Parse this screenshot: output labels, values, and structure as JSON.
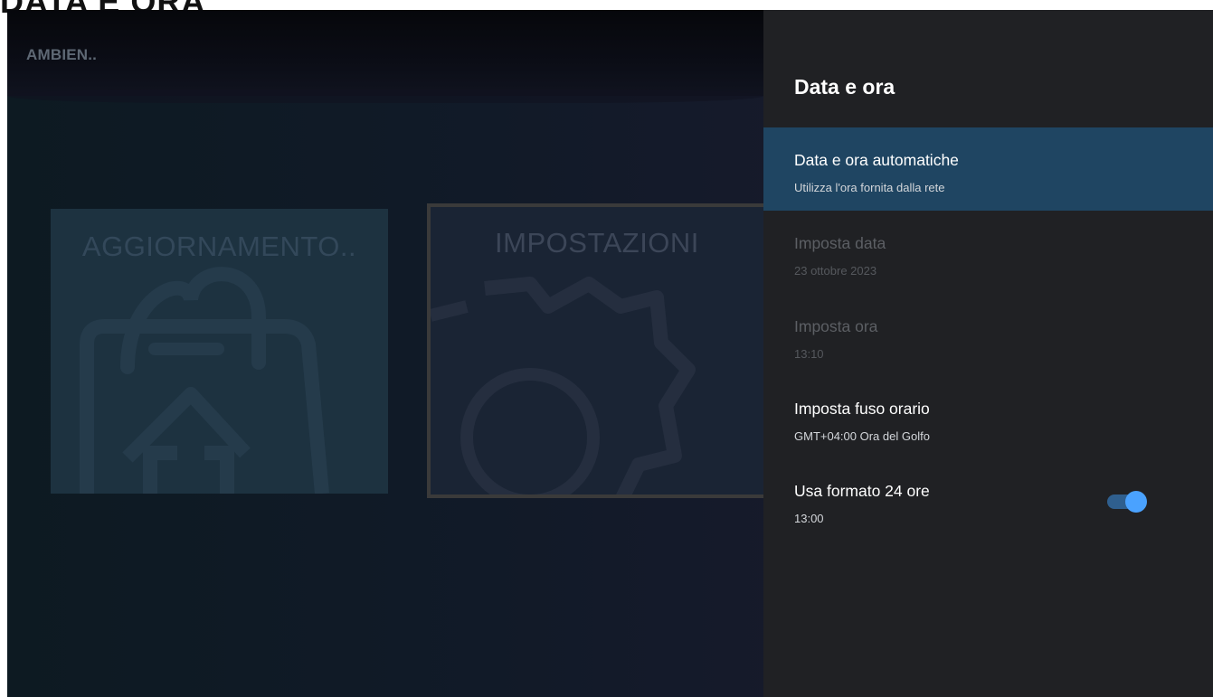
{
  "page": {
    "heading": "DATA E ORA"
  },
  "background": {
    "app_label": "AMBIEN..",
    "tiles": [
      {
        "title": "AGGIORNAMENTO..",
        "icon": "update-bag-icon"
      },
      {
        "title": "IMPOSTAZIONI",
        "icon": "gear-icon"
      }
    ]
  },
  "panel": {
    "title": "Data e ora",
    "items": [
      {
        "title": "Data e ora automatiche",
        "subtitle": "Utilizza l'ora fornita dalla rete",
        "state": "selected"
      },
      {
        "title": "Imposta data",
        "subtitle": "23 ottobre 2023",
        "state": "disabled"
      },
      {
        "title": "Imposta ora",
        "subtitle": "13:10",
        "state": "disabled"
      },
      {
        "title": "Imposta fuso orario",
        "subtitle": "GMT+04:00 Ora del Golfo",
        "state": "enabled"
      },
      {
        "title": "Usa formato 24 ore",
        "subtitle": "13:00",
        "state": "enabled",
        "toggle_on": true
      }
    ]
  },
  "colors": {
    "panel_bg": "#202124",
    "selected_bg": "#1f4562",
    "toggle_accent": "#4aa2ff"
  }
}
